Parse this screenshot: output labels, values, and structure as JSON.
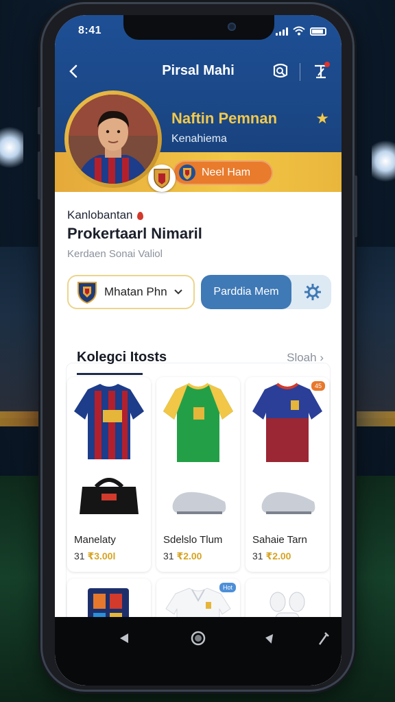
{
  "status_bar": {
    "time": "8:41"
  },
  "topbar": {
    "title": "Pirsal Mahi"
  },
  "profile": {
    "name": "Naftin Pemnan",
    "subtitle": "Kenahiema",
    "team_pill": "Neel Ham"
  },
  "section": {
    "label": "Kanlobantan",
    "title": "Prokertaarl Nimaril",
    "subtitle": "Kerdaen Sonai Valiol"
  },
  "controls": {
    "select_value": "Mhatan Phn",
    "cta_label": "Parddia Mem"
  },
  "collection": {
    "title": "Kolegci Itosts",
    "see_all": "Sloah",
    "products": [
      {
        "name": "Manelaty",
        "price_prefix": "31",
        "price_value": "₹3.00l",
        "badge": ""
      },
      {
        "name": "Sdelslo Tlum",
        "price_prefix": "31",
        "price_value": "₹2.00",
        "badge": ""
      },
      {
        "name": "Sahaie Tarn",
        "price_prefix": "31",
        "price_value": "₹2.00",
        "badge": "45"
      },
      {
        "name": "",
        "price_prefix": "",
        "price_value": "",
        "badge": ""
      },
      {
        "name": "",
        "price_prefix": "",
        "price_value": "",
        "badge": "Hot"
      },
      {
        "name": "",
        "price_prefix": "",
        "price_value": "",
        "badge": ""
      }
    ]
  },
  "colors": {
    "header_blue": "#1e4f95",
    "gold": "#f2c94c",
    "cta_blue": "#3f79b6",
    "orange": "#e87b2c"
  },
  "icons": [
    "back-icon",
    "search-icon",
    "edit-icon",
    "star-icon",
    "chevron-down-icon",
    "gear-icon",
    "chevron-right-icon",
    "nav-back-icon",
    "nav-home-icon",
    "nav-recent-icon",
    "nav-tool-icon"
  ]
}
